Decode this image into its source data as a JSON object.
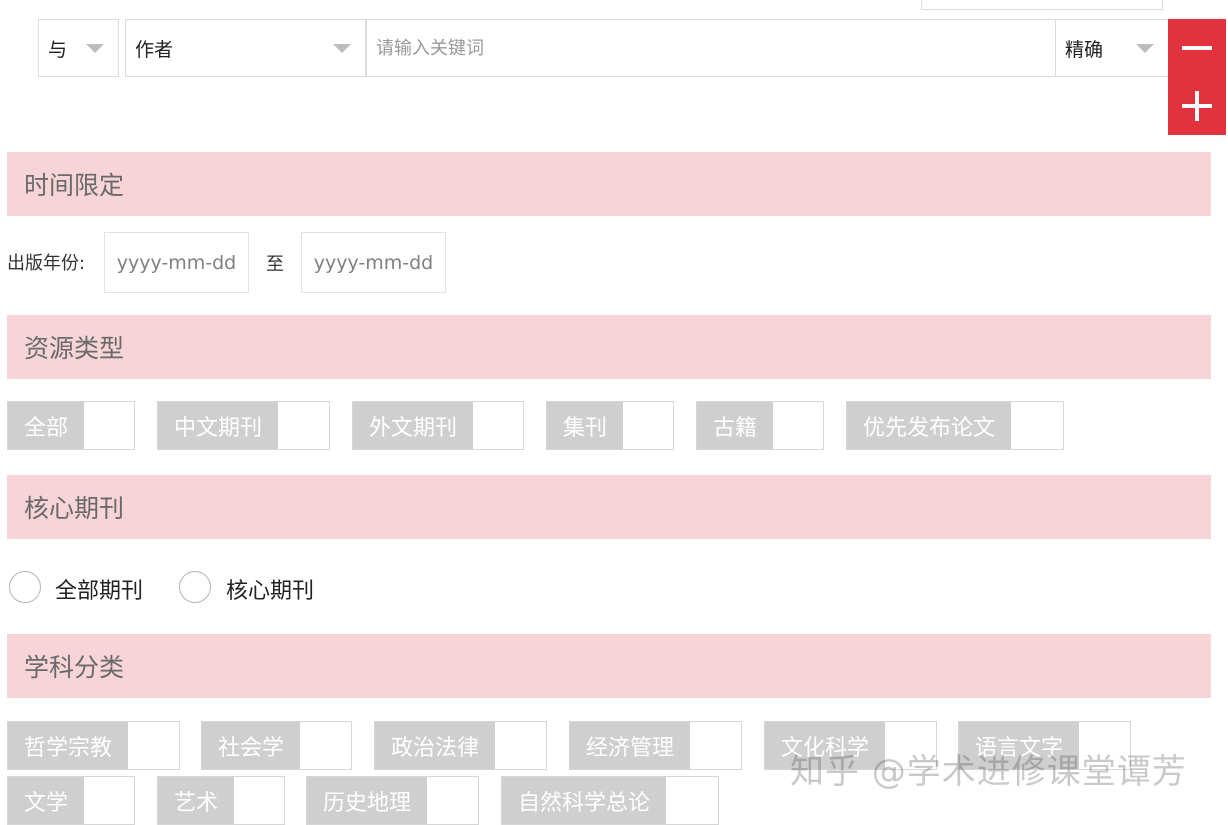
{
  "search": {
    "logic": "与",
    "field": "作者",
    "keyword_placeholder": "请输入关键词",
    "match": "精确"
  },
  "sections": {
    "time": "时间限定",
    "resource": "资源类型",
    "core": "核心期刊",
    "subject": "学科分类"
  },
  "time": {
    "label": "出版年份:",
    "start_placeholder": "yyyy-mm-dd",
    "to": "至",
    "end_placeholder": "yyyy-mm-dd"
  },
  "resource_types": [
    "全部",
    "中文期刊",
    "外文期刊",
    "集刊",
    "古籍",
    "优先发布论文"
  ],
  "core_options": [
    "全部期刊",
    "核心期刊"
  ],
  "subjects": [
    "哲学宗教",
    "社会学",
    "政治法律",
    "经济管理",
    "文化科学",
    "语言文字",
    "文学",
    "艺术",
    "历史地理",
    "自然科学总论"
  ],
  "watermark": "知乎 @学术进修课堂谭芳",
  "colors": {
    "accent_red": "#e2323e",
    "section_bg": "#f7d4d7",
    "tag_fill": "#cfcfcf"
  }
}
